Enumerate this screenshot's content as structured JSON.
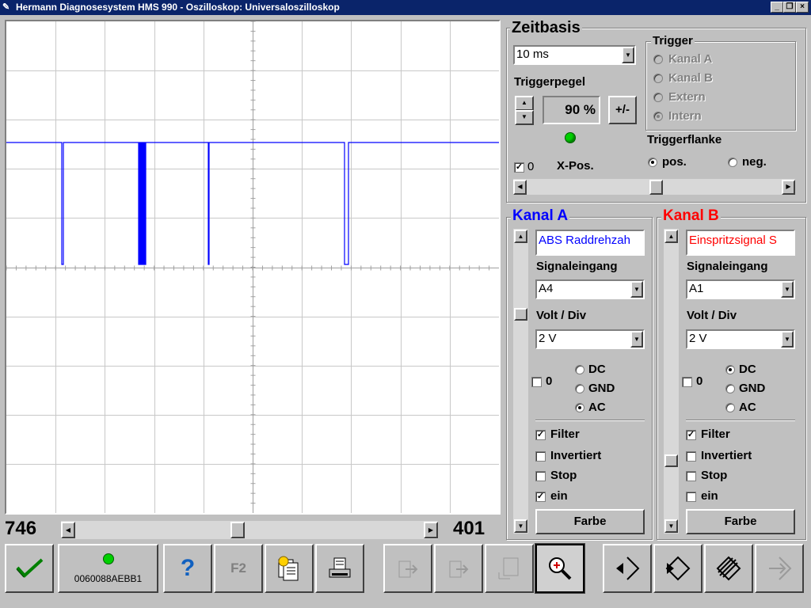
{
  "window": {
    "title": "Hermann Diagnosesystem HMS 990 - Oszilloskop: Universaloszilloskop"
  },
  "timebase": {
    "heading": "Zeitbasis",
    "value": "10 ms",
    "triggerpegel_label": "Triggerpegel",
    "triggerpegel_value": "90 %",
    "plusminus_label": "+/-",
    "zero_label": "0",
    "xpos_label": "X-Pos.",
    "trigger_heading": "Trigger",
    "trigger_options": [
      "Kanal A",
      "Kanal B",
      "Extern",
      "Intern"
    ],
    "triggerflanke_label": "Triggerflanke",
    "flank_pos": "pos.",
    "flank_neg": "neg."
  },
  "channel_a": {
    "heading": "Kanal A",
    "color": "#0000ff",
    "name": "ABS Raddrehzah",
    "signaleingang_label": "Signaleingang",
    "signaleingang_value": "A4",
    "voltdiv_label": "Volt / Div",
    "voltdiv_value": "2 V",
    "zero_label": "0",
    "coupling": [
      "DC",
      "GND",
      "AC"
    ],
    "filter_label": "Filter",
    "invertiert_label": "Invertiert",
    "stop_label": "Stop",
    "ein_label": "ein",
    "farbe_label": "Farbe"
  },
  "channel_b": {
    "heading": "Kanal B",
    "color": "#ff0000",
    "name": "Einspritzsignal S",
    "signaleingang_label": "Signaleingang",
    "signaleingang_value": "A1",
    "voltdiv_label": "Volt / Div",
    "voltdiv_value": "2 V",
    "zero_label": "0",
    "coupling": [
      "DC",
      "GND",
      "AC"
    ],
    "filter_label": "Filter",
    "invertiert_label": "Invertiert",
    "stop_label": "Stop",
    "ein_label": "ein",
    "farbe_label": "Farbe"
  },
  "scope": {
    "left_value": "746",
    "right_value": "401",
    "trace_color": "#0000ff"
  },
  "toolbar": {
    "device_id": "0060088AEBB1",
    "help_label": "?",
    "f2_label": "F2"
  }
}
